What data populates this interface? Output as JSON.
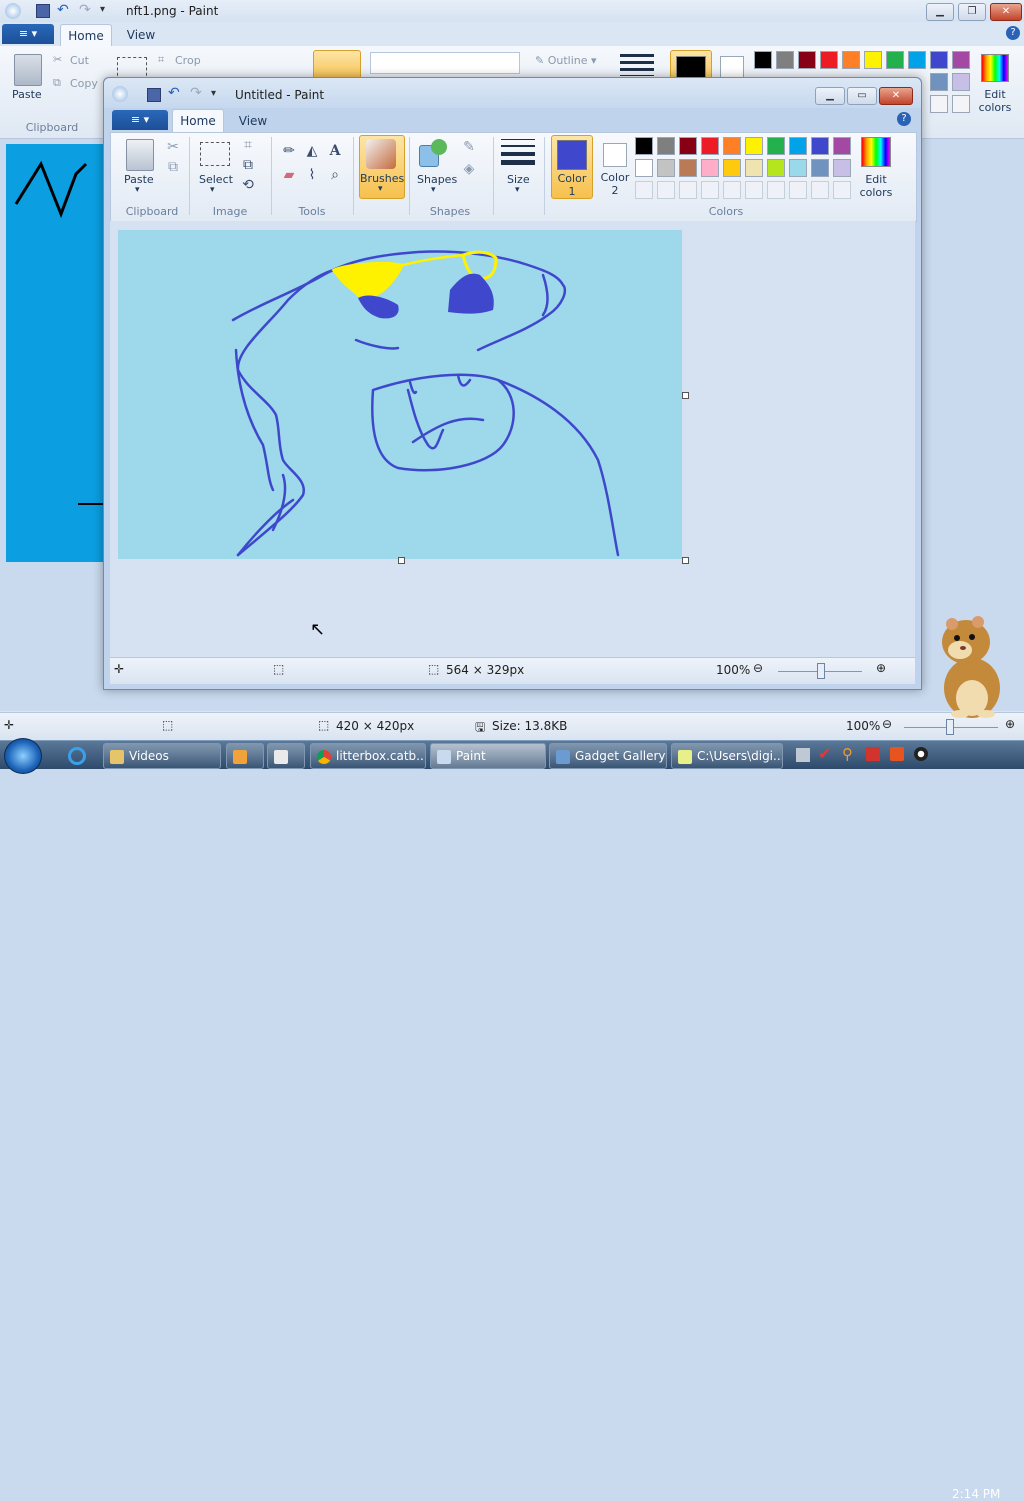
{
  "background_window": {
    "title": "nft1.png - Paint",
    "tabs": {
      "file": "≡ ▾",
      "home": "Home",
      "view": "View"
    },
    "ribbon": {
      "paste": "Paste",
      "cut": "Cut",
      "copy": "Copy",
      "clipboard_group": "Clipboard",
      "crop": "Crop",
      "edit_colors": "Edit colors"
    },
    "status": {
      "canvas_size": "420 × 420px",
      "file_size": "Size: 13.8KB",
      "zoom": "100%"
    }
  },
  "foreground_window": {
    "title": "Untitled - Paint",
    "tabs": {
      "file": "≡ ▾",
      "home": "Home",
      "view": "View"
    },
    "ribbon": {
      "paste": "Paste",
      "select": "Select",
      "brushes": "Brushes",
      "shapes": "Shapes",
      "size": "Size",
      "color1": "Color 1",
      "color2": "Color 2",
      "edit_colors": "Edit colors",
      "groups": {
        "clipboard": "Clipboard",
        "image": "Image",
        "tools": "Tools",
        "shapes": "Shapes",
        "colors": "Colors"
      }
    },
    "palette_row1": [
      "#000000",
      "#7f7f7f",
      "#880015",
      "#ed1c24",
      "#ff7f27",
      "#fff200",
      "#22b14c",
      "#00a2e8",
      "#3f48cc",
      "#a349a4"
    ],
    "palette_row2": [
      "#ffffff",
      "#c3c3c3",
      "#b97a57",
      "#ffaec9",
      "#ffc90e",
      "#efe4b0",
      "#b5e61d",
      "#99d9ea",
      "#7092be",
      "#c8bfe7"
    ],
    "color1": "#3f48cc",
    "color2": "#ffffff",
    "status": {
      "canvas_size": "564 × 329px",
      "zoom": "100%"
    }
  },
  "taskbar": {
    "items": [
      {
        "label": "Videos"
      },
      {
        "label": ""
      },
      {
        "label": ""
      },
      {
        "label": "litterbox.catb..."
      },
      {
        "label": "Paint"
      },
      {
        "label": "Gadget Gallery"
      },
      {
        "label": "C:\\Users\\digi..."
      }
    ],
    "clock": "2:14 PM"
  }
}
